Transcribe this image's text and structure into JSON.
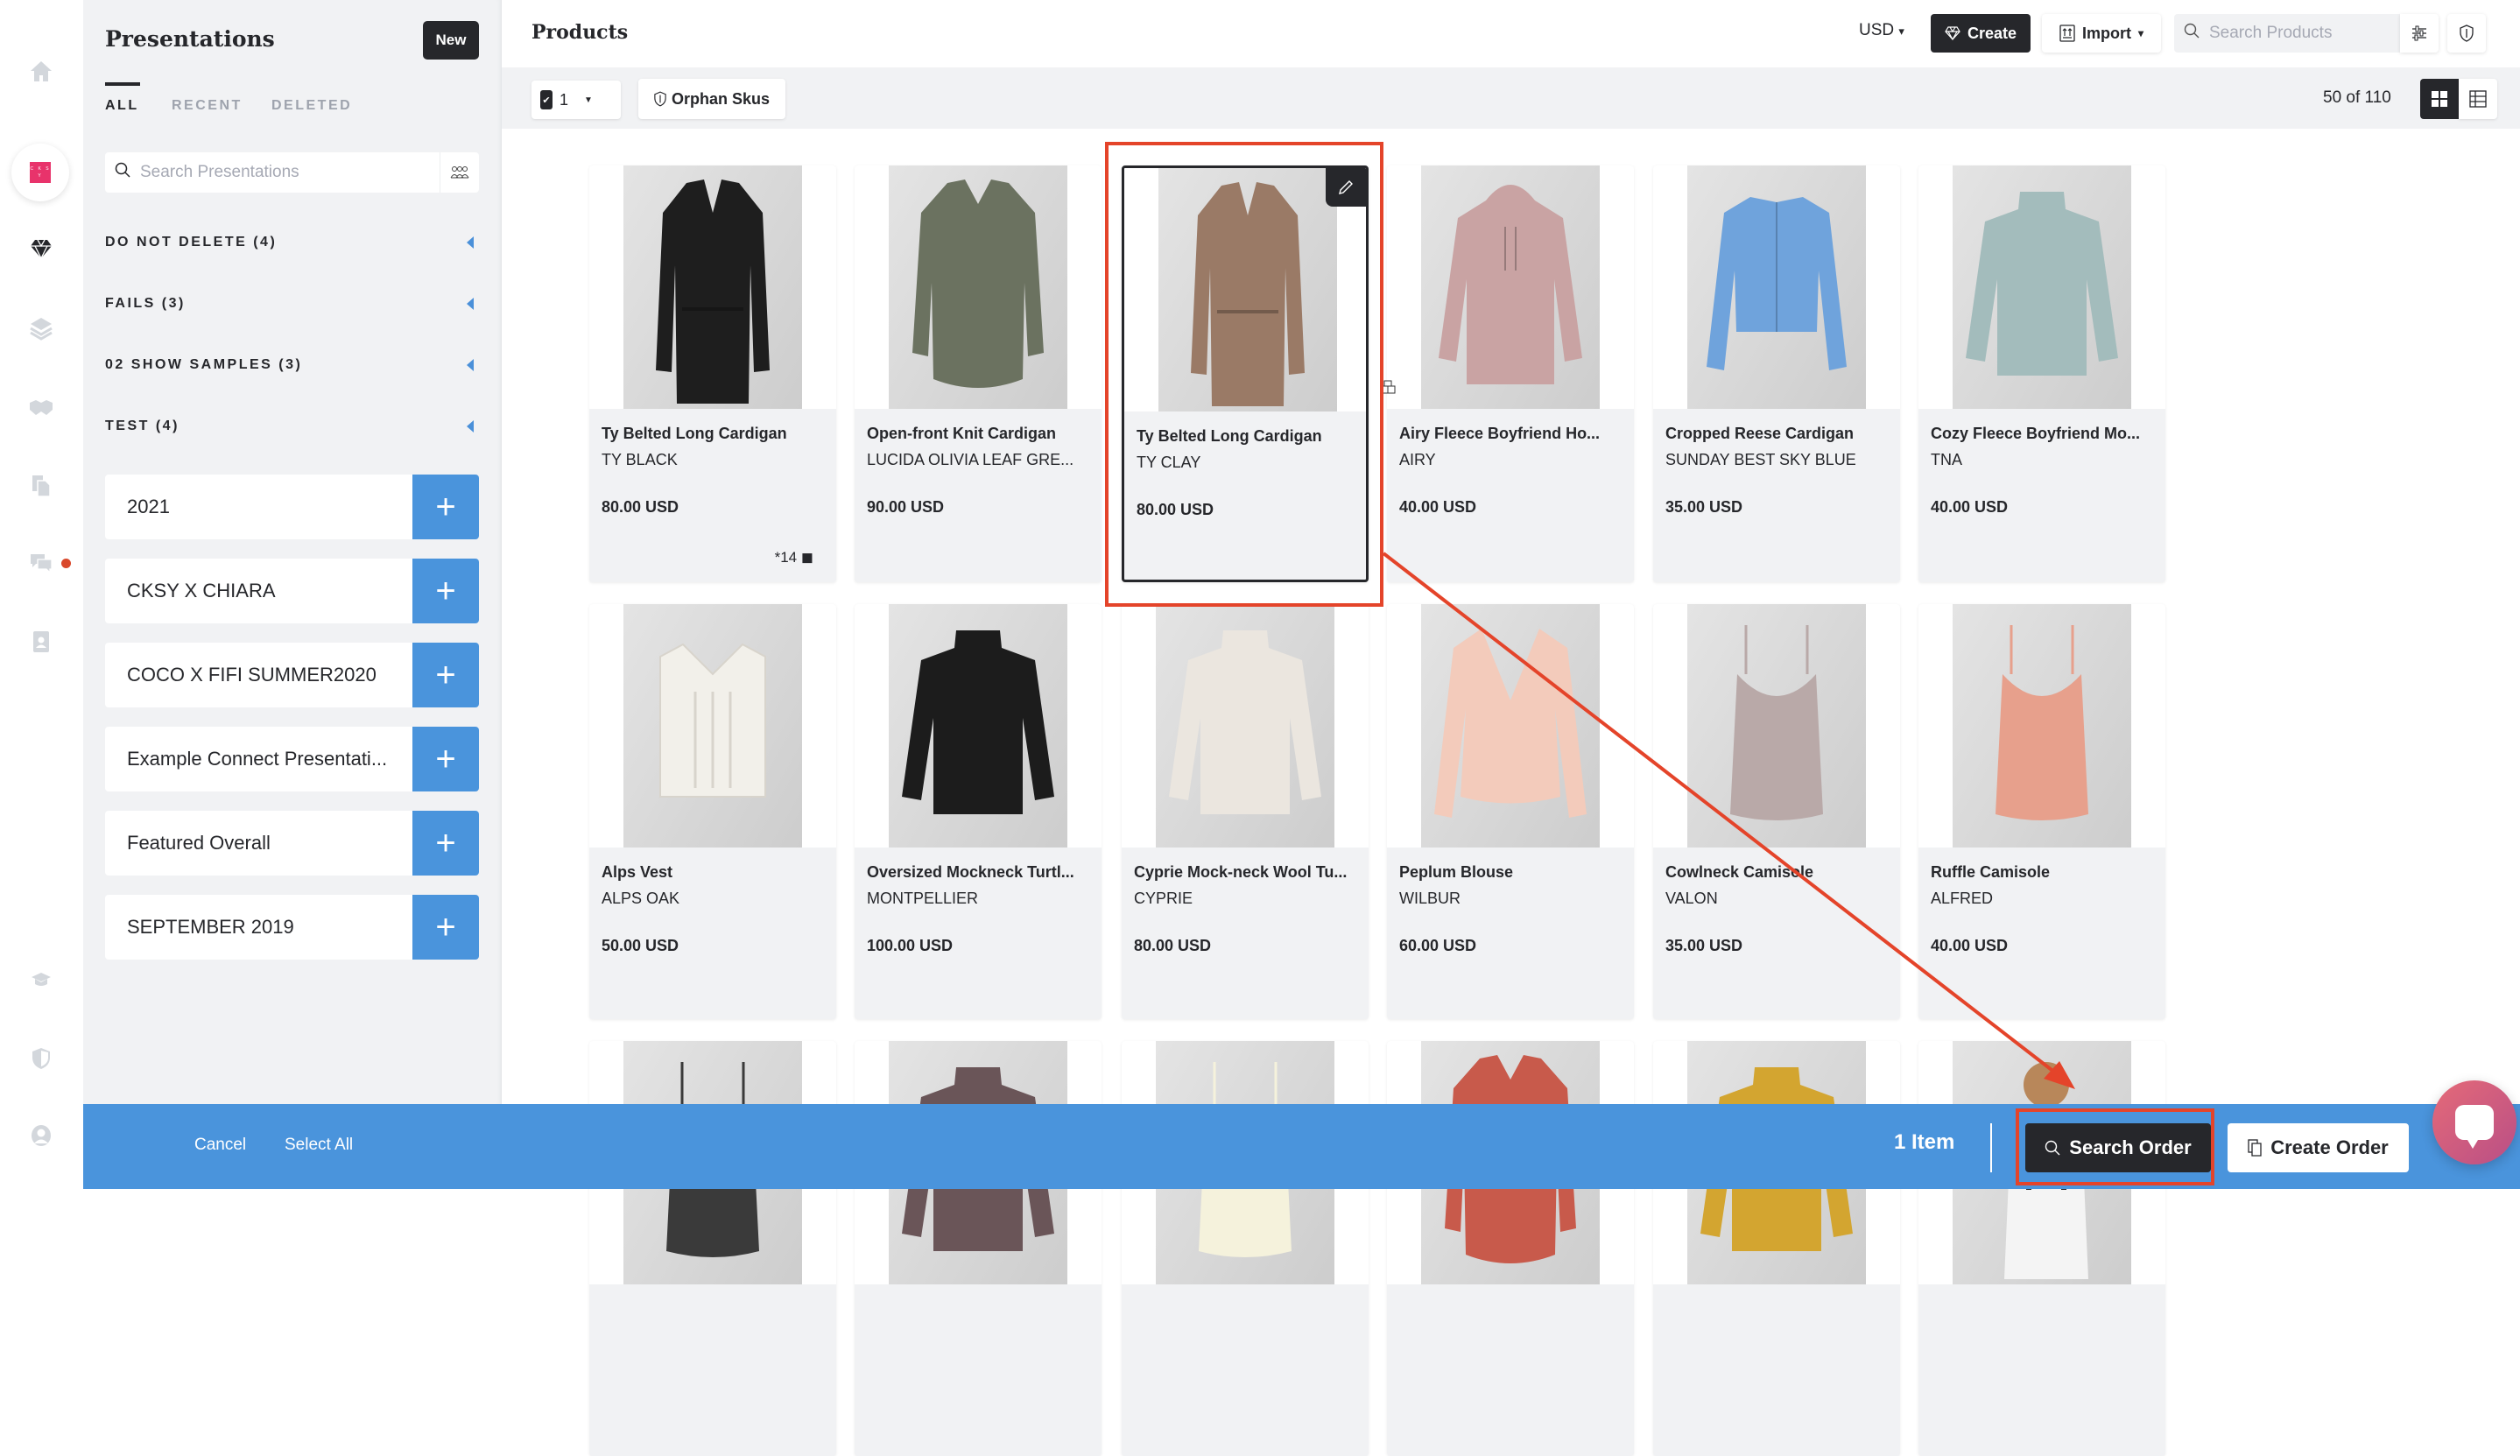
{
  "rail": {
    "icons": [
      "home-icon",
      "brand-logo",
      "diamond-icon",
      "layers-icon",
      "handshake-icon",
      "documents-icon",
      "chat-icon",
      "contact-card-icon",
      "graduation-cap-icon",
      "shield-icon",
      "user-icon"
    ],
    "logo_text": "C K S Y",
    "chat_has_notification": true
  },
  "presentations": {
    "title": "Presentations",
    "new_label": "New",
    "tabs": [
      {
        "label": "ALL",
        "active": true
      },
      {
        "label": "RECENT",
        "active": false
      },
      {
        "label": "DELETED",
        "active": false
      }
    ],
    "search_placeholder": "Search Presentations",
    "folders": [
      {
        "label": "DO NOT DELETE (4)"
      },
      {
        "label": "FAILS (3)"
      },
      {
        "label": "02 SHOW SAMPLES (3)"
      },
      {
        "label": "TEST (4)"
      }
    ],
    "items": [
      {
        "name": "2021"
      },
      {
        "name": "CKSY X CHIARA"
      },
      {
        "name": "COCO X FIFI SUMMER2020"
      },
      {
        "name": "Example Connect Presentati..."
      },
      {
        "name": "Featured Overall"
      },
      {
        "name": "SEPTEMBER 2019"
      }
    ],
    "add_label": "+"
  },
  "header": {
    "title": "Products",
    "currency": "USD",
    "currency_caret": "▾",
    "create_label": "Create",
    "import_label": "Import",
    "import_caret": "▾",
    "search_placeholder": "Search Products"
  },
  "toolbar": {
    "selected_count": "1",
    "orphan_label": "Orphan Skus",
    "results": "50 of 110"
  },
  "products": [
    {
      "name": "Ty Belted Long Cardigan",
      "variant": "TY BLACK",
      "price": "80.00 USD",
      "stock": "*14",
      "color": "#1e1e1e",
      "shape": "long"
    },
    {
      "name": "Open-front Knit Cardigan",
      "variant": "LUCIDA OLIVIA LEAF GRE...",
      "price": "90.00 USD",
      "color": "#6b7260",
      "shape": "mid"
    },
    {
      "name": "Ty Belted Long Cardigan",
      "variant": "TY CLAY",
      "price": "80.00 USD",
      "color": "#9a7a66",
      "shape": "long",
      "selected": true
    },
    {
      "name": "Airy Fleece Boyfriend Ho...",
      "variant": "AIRY",
      "price": "40.00 USD",
      "color": "#c9a3a3",
      "shape": "hoodie"
    },
    {
      "name": "Cropped Reese Cardigan",
      "variant": "SUNDAY BEST SKY BLUE",
      "price": "35.00 USD",
      "color": "#6fa3dc",
      "shape": "crop"
    },
    {
      "name": "Cozy Fleece Boyfriend Mo...",
      "variant": "TNA",
      "price": "40.00 USD",
      "color": "#a3bcbc",
      "shape": "sweater"
    },
    {
      "name": "Alps Vest",
      "variant": "ALPS OAK",
      "price": "50.00 USD",
      "color": "#f2f0ea",
      "shape": "vest"
    },
    {
      "name": "Oversized Mockneck Turtl...",
      "variant": "MONTPELLIER",
      "price": "100.00 USD",
      "color": "#1c1c1c",
      "shape": "sweater"
    },
    {
      "name": "Cyprie Mock-neck Wool Tu...",
      "variant": "CYPRIE",
      "price": "80.00 USD",
      "color": "#ebe6df",
      "shape": "sweater"
    },
    {
      "name": "Peplum Blouse",
      "variant": "WILBUR",
      "price": "60.00 USD",
      "color": "#f3cbbb",
      "shape": "blouse"
    },
    {
      "name": "Cowlneck Camisole",
      "variant": "VALON",
      "price": "35.00 USD",
      "color": "#b9a9a8",
      "shape": "cami"
    },
    {
      "name": "Ruffle Camisole",
      "variant": "ALFRED",
      "price": "40.00 USD",
      "color": "#e7a08c",
      "shape": "cami"
    },
    {
      "name": "",
      "variant": "",
      "price": "",
      "color": "#3a3a3a",
      "shape": "cami"
    },
    {
      "name": "",
      "variant": "",
      "price": "",
      "color": "#6a5558",
      "shape": "sweater"
    },
    {
      "name": "",
      "variant": "",
      "price": "",
      "color": "#f5f2dc",
      "shape": "cami"
    },
    {
      "name": "",
      "variant": "",
      "price": "",
      "color": "#c85a4b",
      "shape": "mid"
    },
    {
      "name": "",
      "variant": "",
      "price": "",
      "color": "#d3a530",
      "shape": "sweater"
    },
    {
      "name": "",
      "variant": "",
      "price": "",
      "color": "#e8e8e8",
      "shape": "person"
    }
  ],
  "bottom_bar": {
    "cancel_label": "Cancel",
    "select_all_label": "Select All",
    "item_count": "1 Item",
    "search_order_label": "Search Order",
    "create_order_label": "Create Order"
  },
  "colors": {
    "accent_blue": "#4a94dc",
    "dark": "#26272b",
    "annotation_red": "#e4442a",
    "brand_pink": "#e8336b"
  }
}
